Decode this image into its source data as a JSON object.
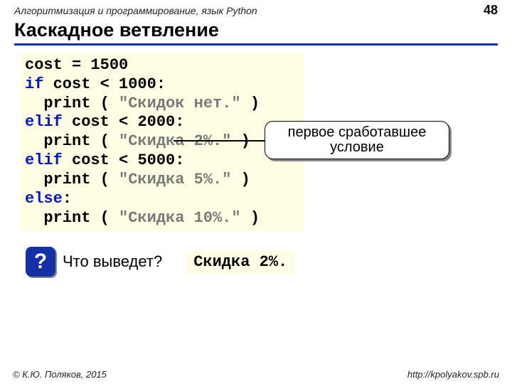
{
  "header": {
    "subject": "Алгоритмизация и программирование, язык Python",
    "page": "48"
  },
  "title": "Каскадное ветвление",
  "code": {
    "l1a": "cost = ",
    "l1num": "1500",
    "l2a": "if",
    "l2b": " cost < ",
    "l2num": "1000",
    "l2c": ":",
    "l3a": "  print ( ",
    "l3str": "\"Скидок нет.\"",
    "l3b": " )",
    "l4a": "elif",
    "l4b": " cost < ",
    "l4num": "2000",
    "l4c": ":",
    "l5a": "  print ( ",
    "l5str": "\"Скидка 2%.\"",
    "l5b": " )",
    "l6a": "elif",
    "l6b": " cost < ",
    "l6num": "5000",
    "l6c": ":",
    "l7a": "  print ( ",
    "l7str": "\"Скидка 5%.\"",
    "l7b": " )",
    "l8a": "else",
    "l8b": ":",
    "l9a": "  print ( ",
    "l9str": "\"Скидка 10%.\"",
    "l9b": " )"
  },
  "callout": {
    "line1": "первое сработавшее",
    "line2": "условие"
  },
  "question": {
    "mark": "?",
    "text": "Что выведет?",
    "answer": "Скидка 2%."
  },
  "footer": {
    "copyright": "© К.Ю. Поляков, 2015",
    "url": "http://kpolyakov.spb.ru"
  }
}
